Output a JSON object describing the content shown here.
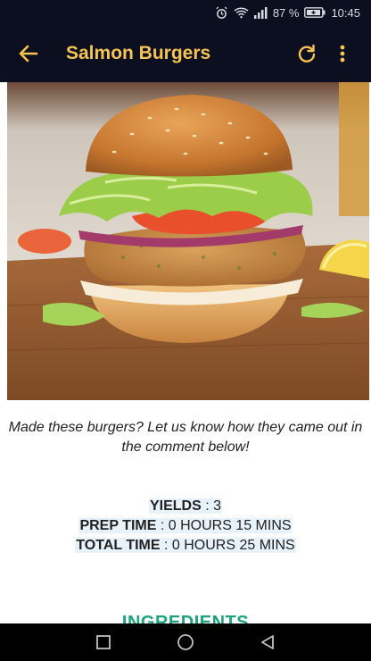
{
  "status_bar": {
    "battery_percent": "87 %",
    "time": "10:45",
    "icons": [
      "alarm-icon",
      "wifi-icon",
      "signal-icon",
      "battery-icon"
    ]
  },
  "app_bar": {
    "title": "Salmon Burgers",
    "icons": [
      "back-arrow-icon",
      "refresh-icon",
      "more-vert-icon"
    ],
    "accent_color": "#f6c453",
    "background_color": "#0c0f20"
  },
  "content": {
    "hero_image": "salmon burger photo",
    "caption": "Made these burgers? Let us know how they came out in the comment below!",
    "yields_label": "YIELDS",
    "yields_value": "3",
    "prep_label": "PREP TIME",
    "prep_value": "0 HOURS 15 MINS",
    "total_label": "TOTAL TIME",
    "total_value": "0 HOURS 25 MINS",
    "section_heading": "INGREDIENTS",
    "section_color": "#1fa37a"
  },
  "nav_bar": {
    "icons": [
      "recents-square-icon",
      "home-circle-icon",
      "back-triangle-icon"
    ]
  }
}
